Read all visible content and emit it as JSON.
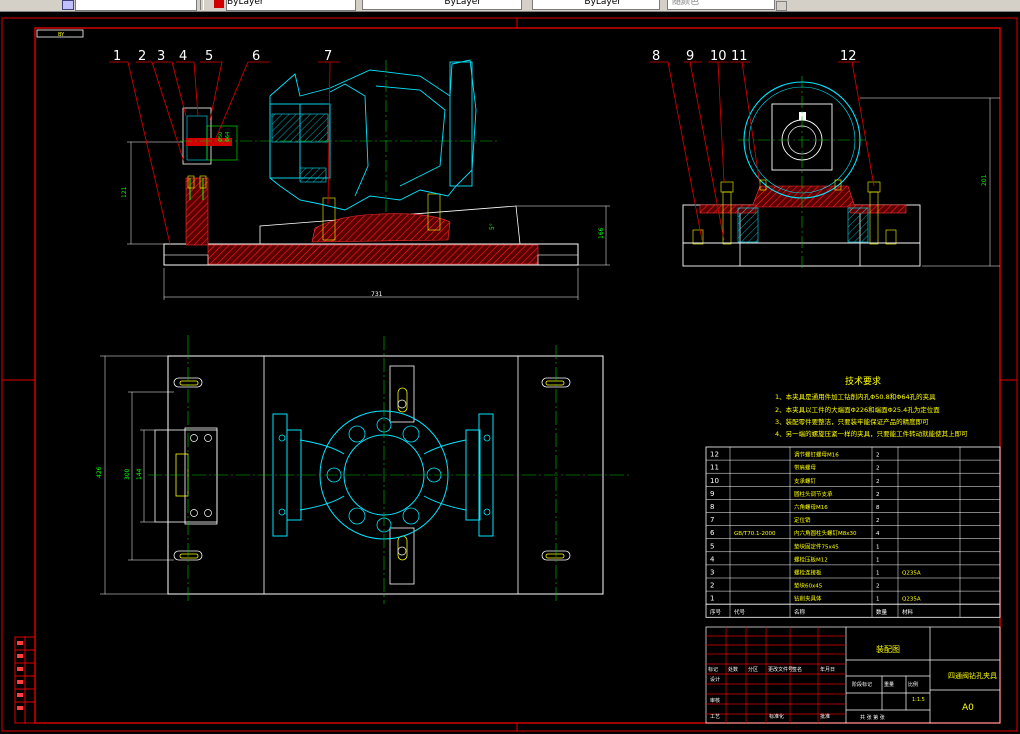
{
  "toolbar": {
    "style_dropdown": "",
    "color_dropdown": "ByLayer",
    "linetype_dropdown": "ByLayer",
    "lineweight_dropdown": "ByLayer",
    "plotstyle_dropdown": "随颜色"
  },
  "drawing": {
    "corner_tag": "BY",
    "balloons": [
      "1",
      "2",
      "3",
      "4",
      "5",
      "6",
      "7",
      "8",
      "9",
      "10",
      "11",
      "12"
    ],
    "dimensions": {
      "front_height": "121",
      "front_height_right": "166",
      "front_width": "731",
      "front_angle": "5°",
      "front_small_a": "Φ50",
      "front_small_b": "Φ64",
      "side_height": "201",
      "plan_height": "426",
      "plan_inner_a": "300",
      "plan_inner_b": "144"
    },
    "tech_req": {
      "title": "技术要求",
      "lines": [
        "1、本夹具是通用件加工钻削内孔Φ50.8和Φ64孔的夹具",
        "2、本夹具以工件的大端面Φ226和端面Φ25.4孔为定位面",
        "3、装配零件要整洁，只要装牢能保证产品的精度即可",
        "4、另一端的螺旋压紧一样的夹具，只要能工件转动就能使其上即可"
      ]
    },
    "bom": {
      "rows": [
        {
          "no": "12",
          "code": "",
          "name": "调节螺钉螺母M16",
          "qty": "2",
          "mat": ""
        },
        {
          "no": "11",
          "code": "",
          "name": "带肩螺母",
          "qty": "2",
          "mat": ""
        },
        {
          "no": "10",
          "code": "",
          "name": "支承螺钉",
          "qty": "2",
          "mat": ""
        },
        {
          "no": "9",
          "code": "",
          "name": "圆柱头调节支承",
          "qty": "2",
          "mat": ""
        },
        {
          "no": "8",
          "code": "",
          "name": "六角螺母M16",
          "qty": "8",
          "mat": ""
        },
        {
          "no": "7",
          "code": "",
          "name": "定位销",
          "qty": "2",
          "mat": ""
        },
        {
          "no": "6",
          "code": "GB/T70.1-2000",
          "name": "内六角圆柱头螺钉M8x30",
          "qty": "4",
          "mat": ""
        },
        {
          "no": "5",
          "code": "",
          "name": "垫块固定件75x45",
          "qty": "1",
          "mat": ""
        },
        {
          "no": "4",
          "code": "",
          "name": "螺栓压板M12",
          "qty": "1",
          "mat": ""
        },
        {
          "no": "3",
          "code": "",
          "name": "螺栓连接板",
          "qty": "1",
          "mat": "Q235A"
        },
        {
          "no": "2",
          "code": "",
          "name": "垫块60x45",
          "qty": "2",
          "mat": ""
        },
        {
          "no": "1",
          "code": "",
          "name": "钻削夹具体",
          "qty": "1",
          "mat": "Q235A"
        }
      ],
      "header": {
        "no": "序号",
        "code": "代号",
        "name": "名称",
        "qty": "数量",
        "mat": "材料"
      }
    },
    "title_block": {
      "drawing_name": "装配图",
      "part_name": "四通阀钻孔夹具",
      "sheet_size": "A0",
      "scale": "1:1.5",
      "labels_left": [
        "标记",
        "处数",
        "分区",
        "更改文件号",
        "签名",
        "年月日"
      ],
      "labels_rows": [
        "设计",
        "审核",
        "工艺"
      ],
      "label_standard": "标准化",
      "label_approve": "批准",
      "label_stage": "阶段标记",
      "label_weight": "重量",
      "label_ratio": "比例",
      "label_sheets": "共 张 第 张"
    },
    "revision_column": [
      "",
      "",
      "",
      "",
      "",
      ""
    ]
  },
  "colors": {
    "border": "#e00000",
    "outline": "#ffffff",
    "geometry": "#00e5ff",
    "center": "#00c800",
    "hatch": "#c00000",
    "text_yellow": "#ffff00",
    "dimension": "#00ff00"
  }
}
